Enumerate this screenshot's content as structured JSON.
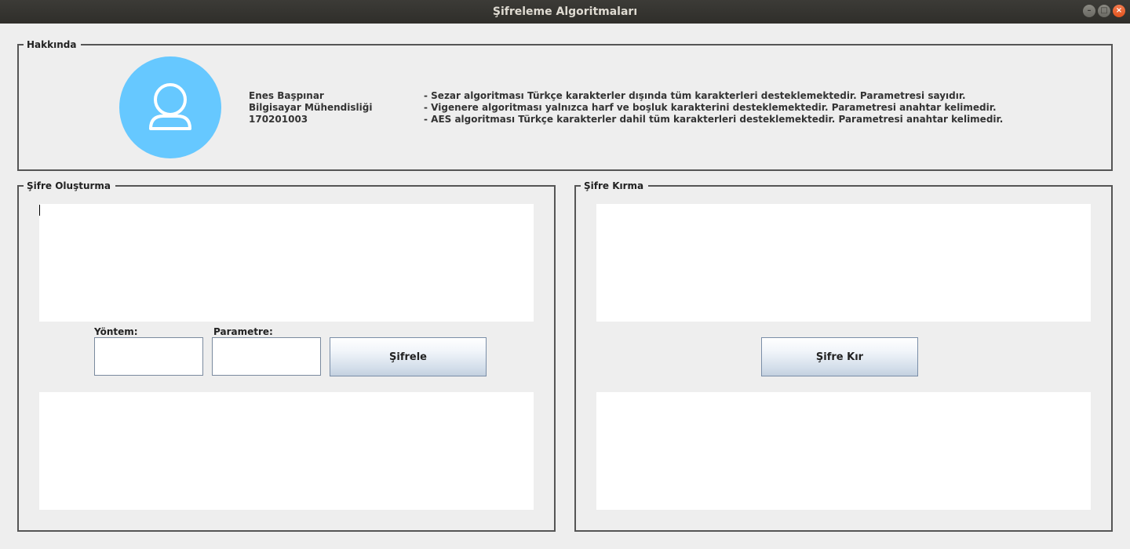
{
  "window": {
    "title": "Şifreleme Algoritmaları",
    "minimize": "–",
    "maximize": "□",
    "close": "×"
  },
  "about": {
    "legend": "Hakkında",
    "name": "Enes Başpınar",
    "department": "Bilgisayar Mühendisliği",
    "student_no": "170201003",
    "notes": [
      "- Sezar algoritması Türkçe karakterler dışında tüm karakterleri desteklemektedir. Parametresi sayıdır.",
      "- Vigenere algoritması yalnızca harf ve boşluk karakterini desteklemektedir. Parametresi anahtar kelimedir.",
      "- AES algoritması Türkçe karakterler dahil tüm karakterleri desteklemektedir. Parametresi anahtar kelimedir."
    ],
    "avatar_icon": "user-icon",
    "avatar_color": "#66c8ff"
  },
  "encrypt": {
    "legend": "Şifre Oluşturma",
    "method_label": "Yöntem:",
    "parameter_label": "Parametre:",
    "button_label": "Şifrele",
    "input_text": "",
    "output_text": ""
  },
  "decrypt": {
    "legend": "Şifre Kırma",
    "button_label": "Şifre Kır",
    "input_text": "",
    "output_text": ""
  }
}
